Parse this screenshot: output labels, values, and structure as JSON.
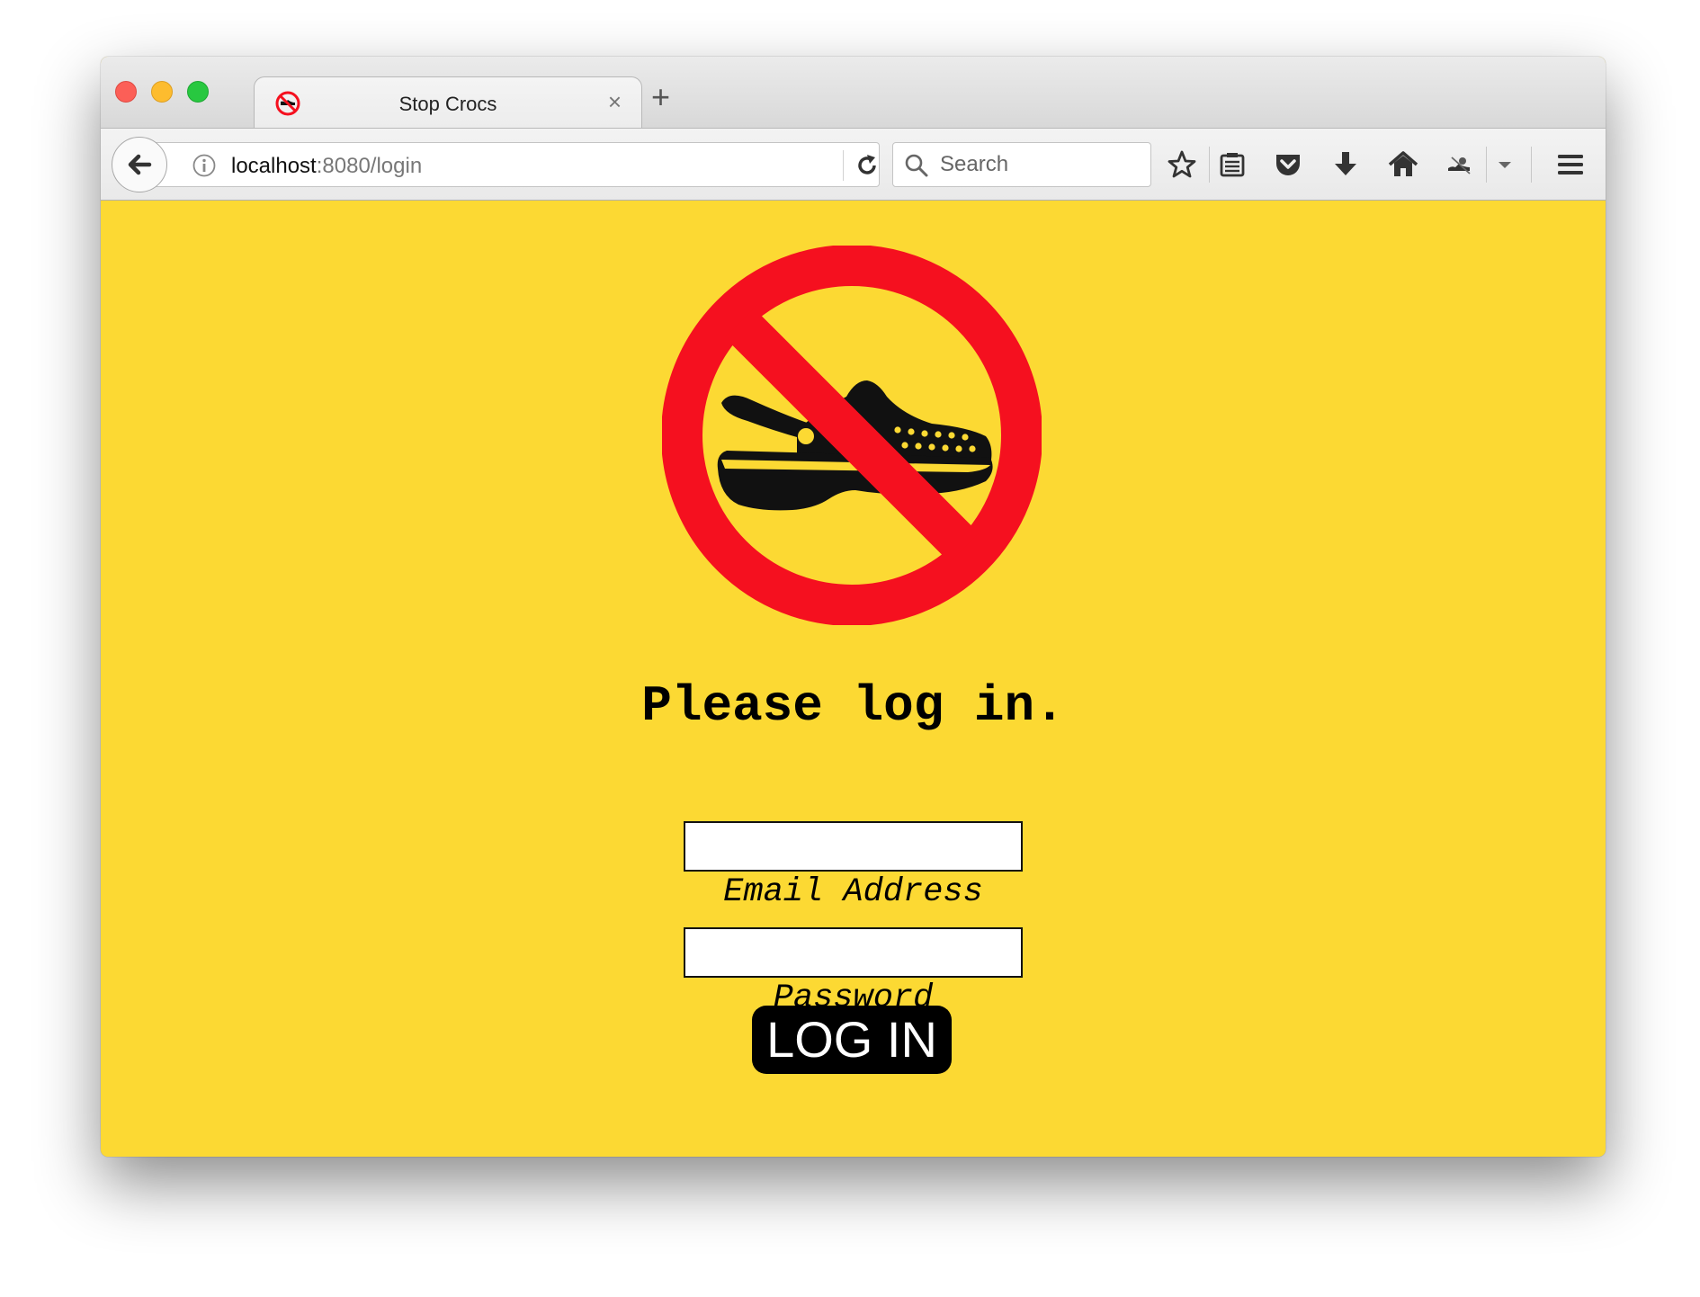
{
  "browser": {
    "tab": {
      "title": "Stop Crocs",
      "close_label": "×"
    },
    "new_tab_label": "+",
    "url": {
      "host": "localhost",
      "rest": ":8080/login"
    },
    "search": {
      "placeholder": "Search"
    }
  },
  "page": {
    "heading": "Please log in.",
    "email_label": "Email Address",
    "password_label": "Password",
    "login_button": "LOG IN",
    "email_value": "",
    "password_value": ""
  },
  "colors": {
    "background": "#fcd933",
    "prohibition_red": "#f5101f",
    "button": "#000000"
  },
  "icons": {
    "logo": "no-crocs-icon",
    "back": "back-arrow-icon",
    "info": "info-icon",
    "reload": "reload-icon",
    "search": "search-icon",
    "bookmark": "star-icon",
    "reader": "reader-list-icon",
    "pocket": "pocket-icon",
    "download": "download-icon",
    "home": "home-icon",
    "extension": "extension-icon",
    "menu": "hamburger-menu-icon"
  }
}
